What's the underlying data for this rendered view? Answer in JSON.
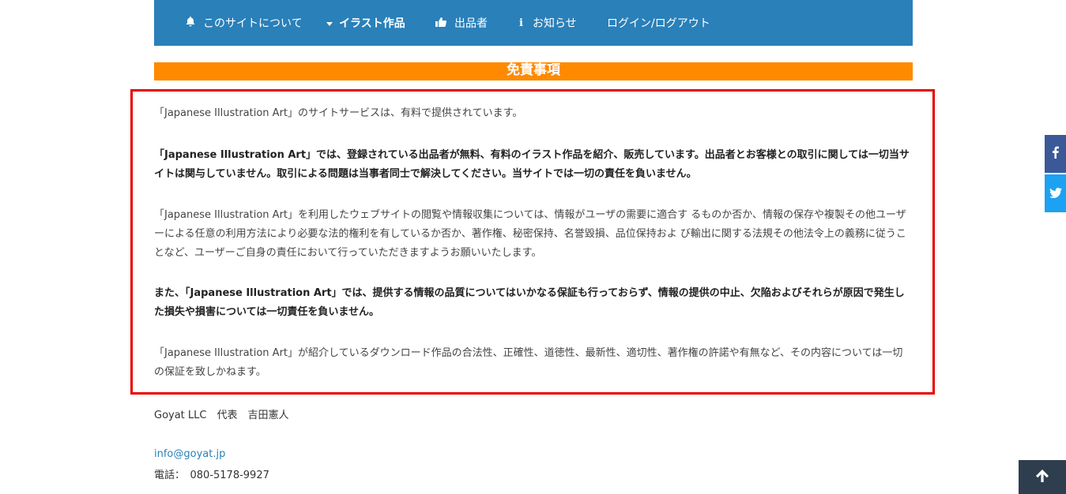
{
  "nav": {
    "items": [
      {
        "icon": "bell-icon",
        "label": "このサイトについて"
      },
      {
        "icon": "caret-down-icon",
        "label": "イラスト作品"
      },
      {
        "icon": "thumbs-up-icon",
        "label": "出品者"
      },
      {
        "icon": "info-icon",
        "label": "お知らせ"
      },
      {
        "icon": "",
        "label": "ログイン/ログアウト"
      }
    ]
  },
  "page": {
    "title": "免責事項"
  },
  "content": {
    "paragraphs": [
      "「Japanese Illustration Art」のサイトサービスは、有料で提供されています。",
      "「Japanese Illustration Art」では、登録されている出品者が無料、有料のイラスト作品を紹介、販売しています。出品者とお客様との取引に関しては一切当サイトは関与していません。取引による問題は当事者同士で解決してください。当サイトでは一切の責任を負いません。",
      "「Japanese Illustration Art」を利用したウェブサイトの閲覧や情報収集については、情報がユーザの需要に適合す るものか否か、情報の保存や複製その他ユーザーによる任意の利用方法により必要な法的権利を有しているか否か、著作権、秘密保持、名誉毀損、品位保持およ び輸出に関する法規その他法令上の義務に従うことなど、ユーザーご自身の責任において行っていただきますようお願いいたします。",
      "また、「Japanese Illustration Art」では、提供する情報の品質についてはいかなる保証も行っておらず、情報の提供の中止、欠陥およびそれらが原因で発生した損失や損害については一切責任を負いません。",
      "「Japanese Illustration Art」が紹介しているダウンロード作品の合法性、正確性、道徳性、最新性、適切性、著作権の許諾や有無など、その内容については一切の保証を致しかねます。"
    ]
  },
  "footer": {
    "company": "Goyat LLC　代表　吉田憲人",
    "email": "info@goyat.jp",
    "phone": "電話：　080-5178-9927"
  },
  "colors": {
    "nav_bg": "#2a80b9",
    "title_bg": "#ff8a00",
    "highlight_border": "#e60000",
    "facebook": "#3b5998",
    "twitter": "#1da1f2",
    "to_top_bg": "#2f3e4e"
  }
}
